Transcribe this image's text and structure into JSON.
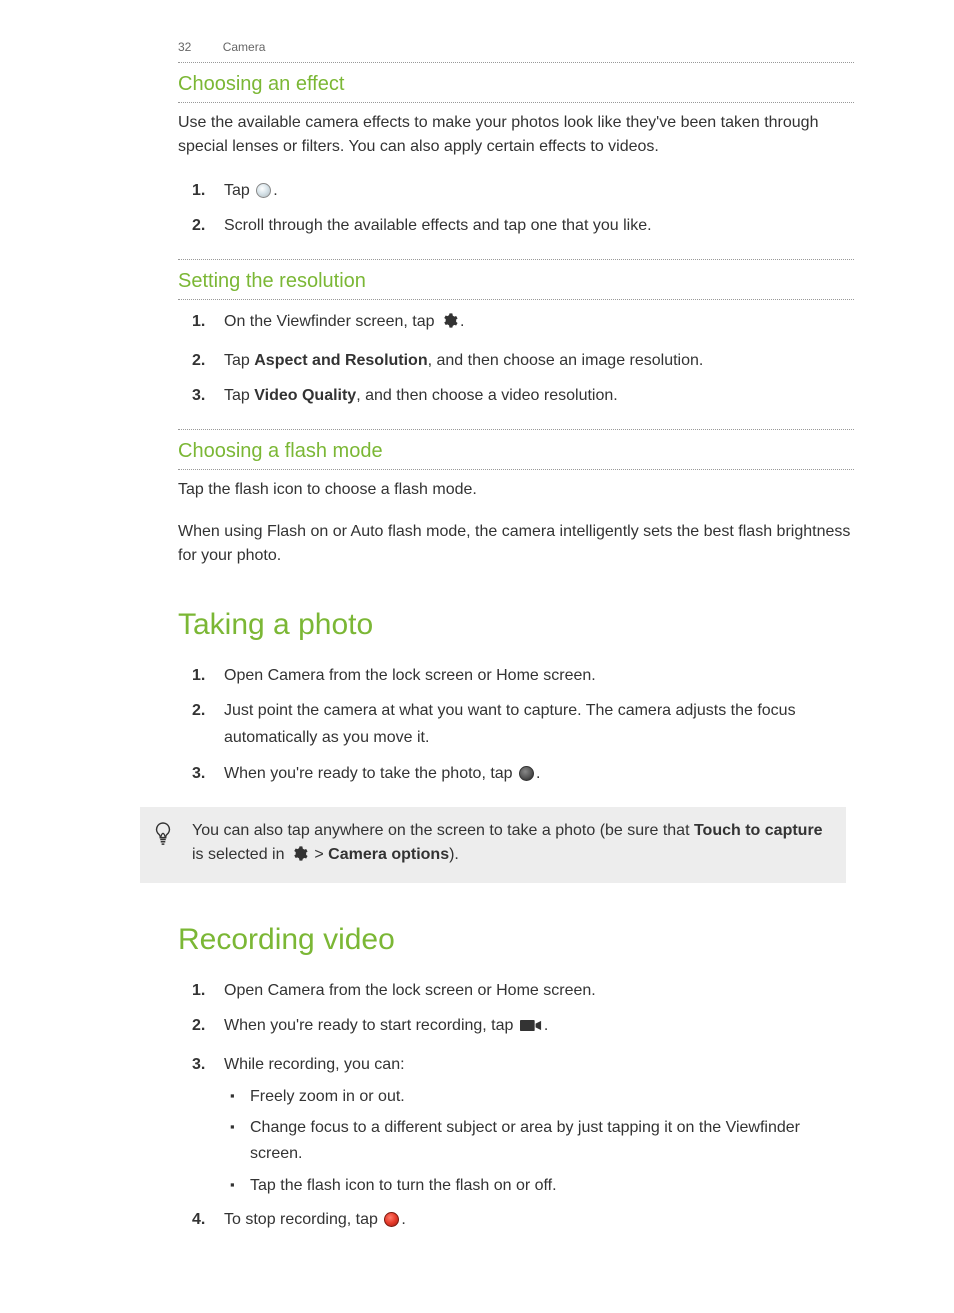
{
  "header": {
    "page_number": "32",
    "section": "Camera"
  },
  "s1": {
    "title": "Choosing an effect",
    "intro": "Use the available camera effects to make your photos look like they've been taken through special lenses or filters. You can also apply certain effects to videos.",
    "step1_pre": "Tap ",
    "step1_post": ".",
    "step2": "Scroll through the available effects and tap one that you like."
  },
  "s2": {
    "title": "Setting the resolution",
    "step1_pre": "On the Viewfinder screen, tap ",
    "step1_post": ".",
    "step2_pre": "Tap ",
    "step2_bold": "Aspect and Resolution",
    "step2_post": ", and then choose an image resolution.",
    "step3_pre": "Tap ",
    "step3_bold": "Video Quality",
    "step3_post": ", and then choose a video resolution."
  },
  "s3": {
    "title": "Choosing a flash mode",
    "p1": "Tap the flash icon to choose a flash mode.",
    "p2": "When using Flash on or Auto flash mode, the camera intelligently sets the best flash brightness for your photo."
  },
  "s4": {
    "title": "Taking a photo",
    "step1": "Open Camera from the lock screen or Home screen.",
    "step2": "Just point the camera at what you want to capture. The camera adjusts the focus automatically as you move it.",
    "step3_pre": "When you're ready to take the photo, tap ",
    "step3_post": "."
  },
  "tip": {
    "t1": "You can also tap anywhere on the screen to take a photo (be sure that ",
    "t_bold1": "Touch to capture",
    "t2": " is selected in ",
    "t3": " > ",
    "t_bold2": "Camera options",
    "t4": ")."
  },
  "s5": {
    "title": "Recording video",
    "step1": "Open Camera from the lock screen or Home screen.",
    "step2_pre": "When you're ready to start recording, tap ",
    "step2_post": ".",
    "step3": "While recording, you can:",
    "b1": "Freely zoom in or out.",
    "b2": "Change focus to a different subject or area by just tapping it on the Viewfinder screen.",
    "b3": "Tap the flash icon to turn the flash on or off.",
    "step4_pre": "To stop recording, tap ",
    "step4_post": "."
  }
}
